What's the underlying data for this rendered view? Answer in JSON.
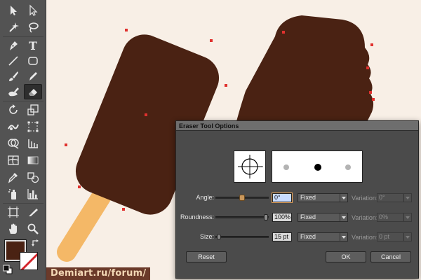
{
  "colors": {
    "canvas_bg": "#f8efe6",
    "chocolate": "#4a2213",
    "stick": "#f4b867",
    "anchor": "#e0312e",
    "toolbar_bg": "#535353",
    "fill_color": "#4a2213"
  },
  "toolbar": {
    "tools": [
      {
        "name": "selection-tool",
        "icon": "arrow-icon"
      },
      {
        "name": "direct-selection-tool",
        "icon": "hollow-arrow-icon"
      },
      {
        "name": "magic-wand-tool",
        "icon": "magic-wand-icon"
      },
      {
        "name": "lasso-tool",
        "icon": "lasso-icon"
      },
      {
        "name": "pen-tool",
        "icon": "pen-icon"
      },
      {
        "name": "type-tool",
        "icon": "type-icon"
      },
      {
        "name": "line-tool",
        "icon": "line-icon"
      },
      {
        "name": "rectangle-tool",
        "icon": "rounded-rect-icon"
      },
      {
        "name": "paintbrush-tool",
        "icon": "brush-icon"
      },
      {
        "name": "pencil-tool",
        "icon": "pencil-icon"
      },
      {
        "name": "blob-brush-tool",
        "icon": "blob-brush-icon"
      },
      {
        "name": "eraser-tool",
        "icon": "eraser-icon",
        "active": true
      },
      {
        "name": "rotate-tool",
        "icon": "rotate-icon"
      },
      {
        "name": "scale-tool",
        "icon": "scale-icon"
      },
      {
        "name": "warp-tool",
        "icon": "warp-icon"
      },
      {
        "name": "free-transform-tool",
        "icon": "free-transform-icon"
      },
      {
        "name": "shape-builder-tool",
        "icon": "shape-builder-icon"
      },
      {
        "name": "perspective-grid-tool",
        "icon": "perspective-grid-icon"
      },
      {
        "name": "mesh-tool",
        "icon": "mesh-icon"
      },
      {
        "name": "gradient-tool",
        "icon": "gradient-icon"
      },
      {
        "name": "eyedropper-tool",
        "icon": "eyedropper-icon"
      },
      {
        "name": "blend-tool",
        "icon": "blend-icon"
      },
      {
        "name": "symbol-sprayer-tool",
        "icon": "spray-icon"
      },
      {
        "name": "column-graph-tool",
        "icon": "column-graph-icon"
      },
      {
        "name": "artboard-tool",
        "icon": "artboard-icon"
      },
      {
        "name": "slice-tool",
        "icon": "slice-icon"
      },
      {
        "name": "hand-tool",
        "icon": "hand-icon"
      },
      {
        "name": "zoom-tool",
        "icon": "zoom-icon"
      }
    ],
    "type_glyph": "T"
  },
  "watermark": "Demiart.ru/forum/",
  "dialog": {
    "title": "Eraser Tool Options",
    "angle": {
      "label": "Angle:",
      "value": "0°",
      "mode": "Fixed",
      "variation_label": "Variation:",
      "variation_value": "0°"
    },
    "roundness": {
      "label": "Roundness:",
      "value": "100%",
      "mode": "Fixed",
      "variation_label": "Variation:",
      "variation_value": "0%"
    },
    "size": {
      "label": "Size:",
      "value": "15 pt",
      "mode": "Fixed",
      "variation_label": "Variation:",
      "variation_value": "0 pt"
    },
    "reset_label": "Reset",
    "ok_label": "OK",
    "cancel_label": "Cancel"
  }
}
